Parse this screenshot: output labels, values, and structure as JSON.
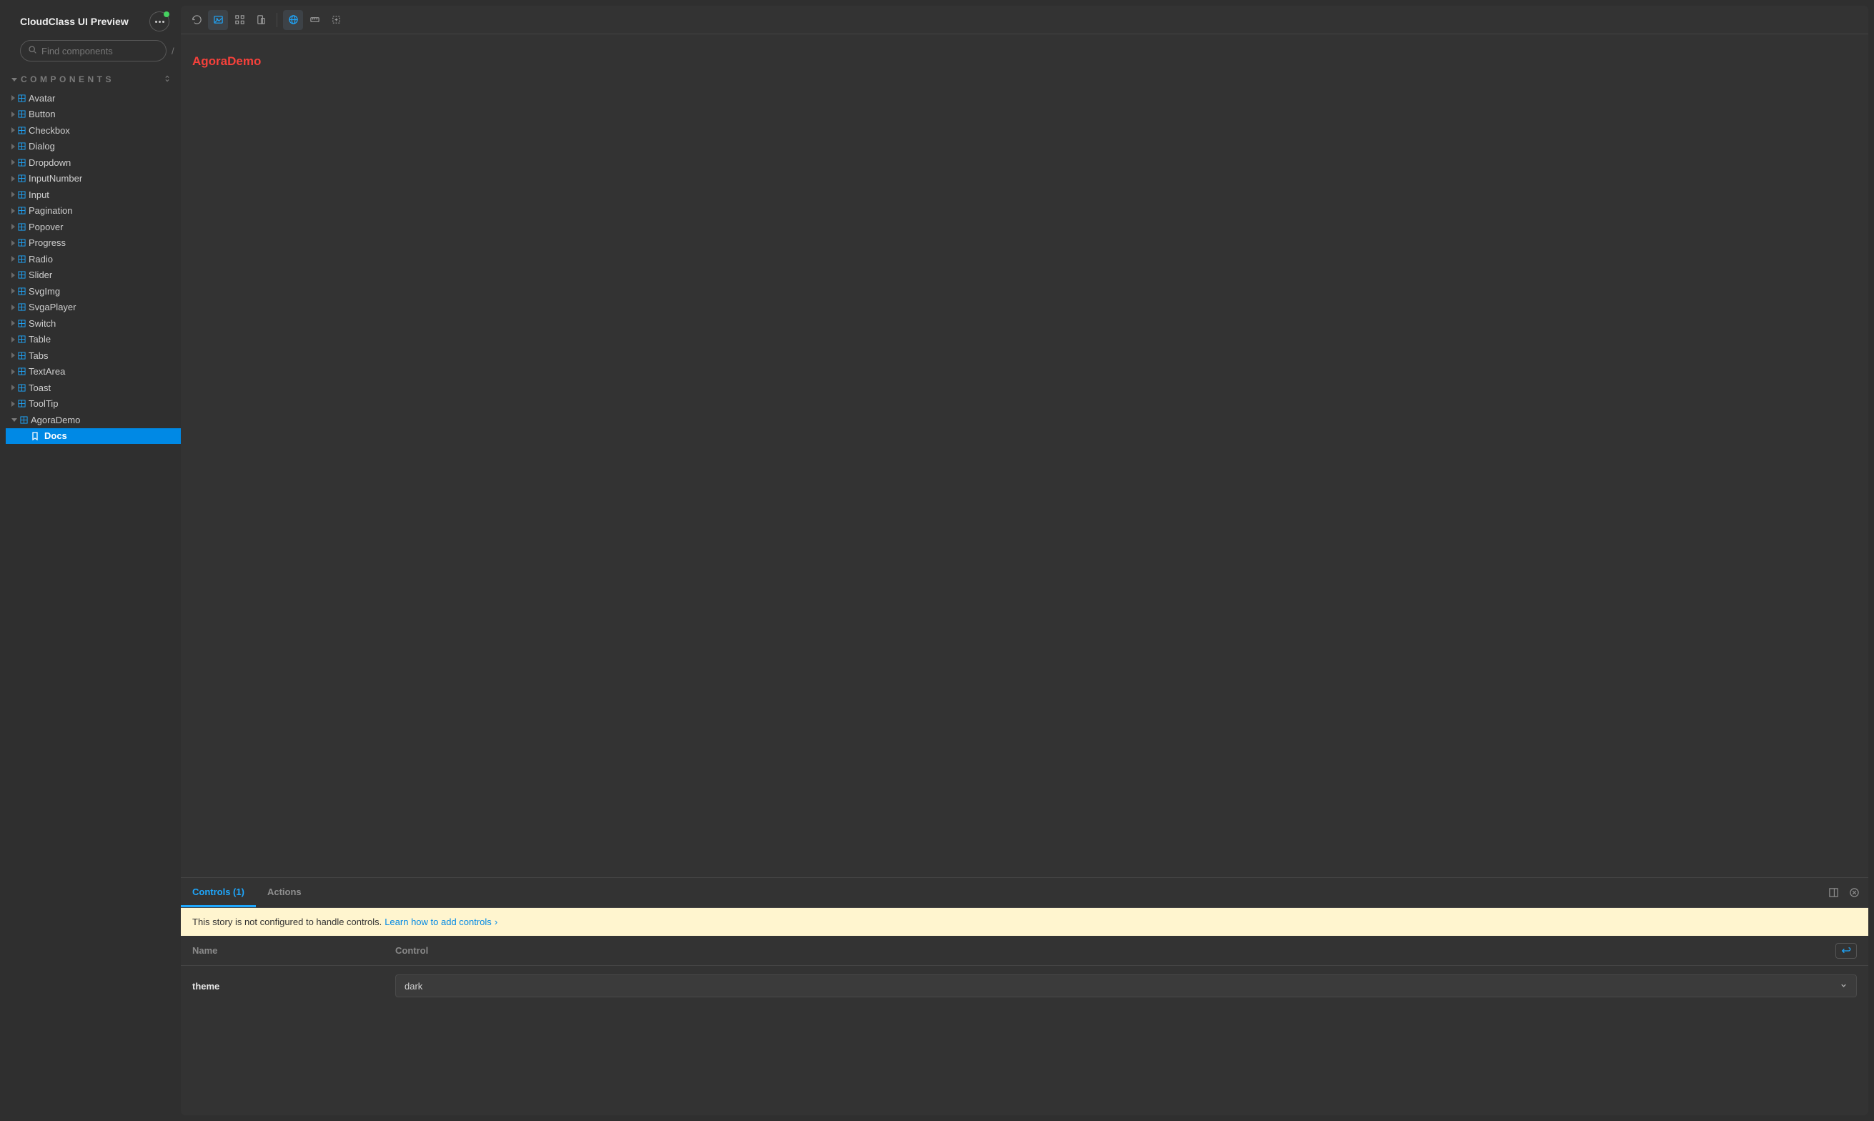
{
  "app": {
    "title": "CloudClass UI Preview"
  },
  "search": {
    "placeholder": "Find components",
    "shortcut": "/"
  },
  "section": {
    "title": "COMPONENTS"
  },
  "tree": {
    "items": [
      {
        "label": "Avatar"
      },
      {
        "label": "Button"
      },
      {
        "label": "Checkbox"
      },
      {
        "label": "Dialog"
      },
      {
        "label": "Dropdown"
      },
      {
        "label": "InputNumber"
      },
      {
        "label": "Input"
      },
      {
        "label": "Pagination"
      },
      {
        "label": "Popover"
      },
      {
        "label": "Progress"
      },
      {
        "label": "Radio"
      },
      {
        "label": "Slider"
      },
      {
        "label": "SvgImg"
      },
      {
        "label": "SvgaPlayer"
      },
      {
        "label": "Switch"
      },
      {
        "label": "Table"
      },
      {
        "label": "Tabs"
      },
      {
        "label": "TextArea"
      },
      {
        "label": "Toast"
      },
      {
        "label": "ToolTip"
      }
    ],
    "expanded": {
      "label": "AgoraDemo"
    },
    "child": {
      "label": "Docs"
    }
  },
  "canvas": {
    "demo_text": "AgoraDemo"
  },
  "addons": {
    "tabs": {
      "controls": "Controls (1)",
      "actions": "Actions"
    },
    "notice": {
      "text": "This story is not configured to handle controls. ",
      "link": "Learn how to add controls"
    },
    "headers": {
      "name": "Name",
      "control": "Control"
    },
    "rows": [
      {
        "name": "theme",
        "value": "dark"
      }
    ]
  }
}
